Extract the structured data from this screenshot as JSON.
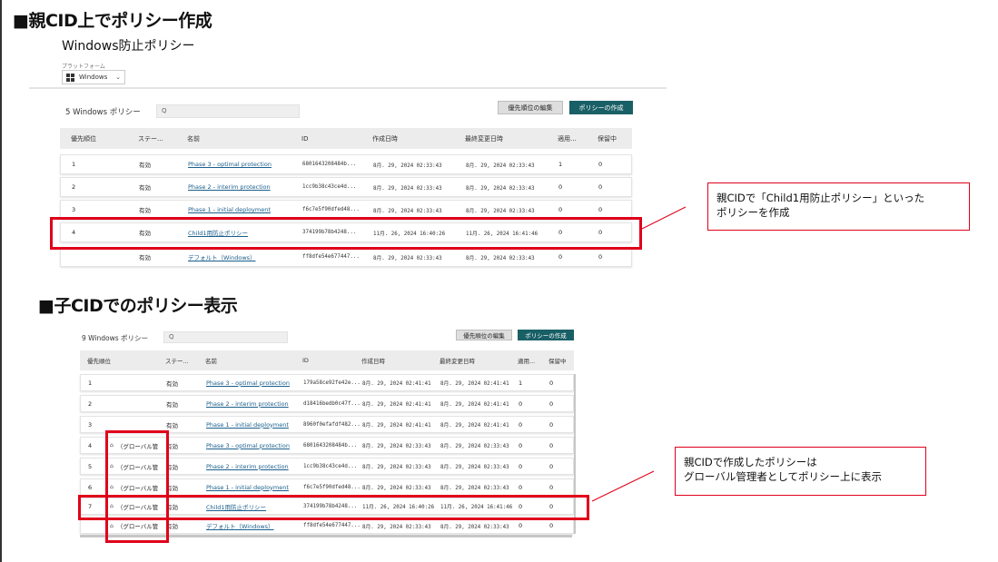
{
  "heading1": "■親CID上でポリシー作成",
  "heading2": "■子CIDでのポリシー表示",
  "parent": {
    "title": "Windows防止ポリシー",
    "platform_label": "プラットフォーム",
    "platform_value": "Windows",
    "count_label": "5 Windows ポリシー",
    "search_placeholder": "Q",
    "edit_priority_label": "優先順位の編集",
    "create_policy_label": "ポリシーの作成",
    "columns": [
      "優先順位",
      "ステー...",
      "名前",
      "ID",
      "作成日時",
      "最終変更日時",
      "適用...",
      "保留中"
    ],
    "rows": [
      {
        "priority": "1",
        "status": "有効",
        "name": "Phase 3 - optimal protection",
        "id": "6801643208484b...",
        "created": "8月. 29, 2024 02:33:43",
        "modified": "8月. 29, 2024 02:33:43",
        "applied": "1",
        "pending": "0"
      },
      {
        "priority": "2",
        "status": "有効",
        "name": "Phase 2 - interim protection",
        "id": "1cc9b38c43ce4d...",
        "created": "8月. 29, 2024 02:33:43",
        "modified": "8月. 29, 2024 02:33:43",
        "applied": "0",
        "pending": "0"
      },
      {
        "priority": "3",
        "status": "有効",
        "name": "Phase 1 - initial deployment",
        "id": "f6c7e5f90dfed48...",
        "created": "8月. 29, 2024 02:33:43",
        "modified": "8月. 29, 2024 02:33:43",
        "applied": "0",
        "pending": "0"
      },
      {
        "priority": "4",
        "status": "有効",
        "name": "Child1用防止ポリシー",
        "id": "374199b78b4248...",
        "created": "11月. 26, 2024 16:40:26",
        "modified": "11月. 26, 2024 16:41:46",
        "applied": "0",
        "pending": "0"
      },
      {
        "priority": "",
        "status": "有効",
        "name": "デフォルト（Windows）",
        "id": "ff8dfe54e677447...",
        "created": "8月. 29, 2024 02:33:43",
        "modified": "8月. 29, 2024 02:33:43",
        "applied": "0",
        "pending": "0"
      }
    ]
  },
  "child": {
    "count_label": "9 Windows ポリシー",
    "search_placeholder": "Q",
    "edit_priority_label": "優先順位の編集",
    "create_policy_label": "ポリシーの作成",
    "columns": [
      "優先順位",
      "ステー...",
      "名前",
      "ID",
      "作成日時",
      "最終変更日時",
      "適用...",
      "保留中"
    ],
    "rows": [
      {
        "priority": "1",
        "global": "",
        "status": "有効",
        "name": "Phase 3 - optimal protection",
        "id": "179a58ce92fe42e...",
        "created": "8月. 29, 2024 02:41:41",
        "modified": "8月. 29, 2024 02:41:41",
        "applied": "1",
        "pending": "0"
      },
      {
        "priority": "2",
        "global": "",
        "status": "有効",
        "name": "Phase 2 - interim protection",
        "id": "d18416bedb0c47f...",
        "created": "8月. 29, 2024 02:41:41",
        "modified": "8月. 29, 2024 02:41:41",
        "applied": "0",
        "pending": "0"
      },
      {
        "priority": "3",
        "global": "",
        "status": "有効",
        "name": "Phase 1 - initial deployment",
        "id": "8960f0efafdf482...",
        "created": "8月. 29, 2024 02:41:41",
        "modified": "8月. 29, 2024 02:41:41",
        "applied": "0",
        "pending": "0"
      },
      {
        "priority": "4",
        "global": "（グローバル管",
        "status": "有効",
        "name": "Phase 3 - optimal protection",
        "id": "6801643208484b...",
        "created": "8月. 29, 2024 02:33:43",
        "modified": "8月. 29, 2024 02:33:43",
        "applied": "0",
        "pending": "0"
      },
      {
        "priority": "5",
        "global": "（グローバル管",
        "status": "有効",
        "name": "Phase 2 - interim protection",
        "id": "1cc9b38c43ce4d...",
        "created": "8月. 29, 2024 02:33:43",
        "modified": "8月. 29, 2024 02:33:43",
        "applied": "0",
        "pending": "0"
      },
      {
        "priority": "6",
        "global": "（グローバル管",
        "status": "有効",
        "name": "Phase 1 - initial deployment",
        "id": "f6c7e5f90dfed48...",
        "created": "8月. 29, 2024 02:33:43",
        "modified": "8月. 29, 2024 02:33:43",
        "applied": "0",
        "pending": "0"
      },
      {
        "priority": "7",
        "global": "（グローバル管",
        "status": "有効",
        "name": "Child1用防止ポリシー",
        "id": "374199b78b4248...",
        "created": "11月. 26, 2024 16:40:26",
        "modified": "11月. 26, 2024 16:41:46",
        "applied": "0",
        "pending": "0"
      },
      {
        "priority": "",
        "global": "（グローバル管",
        "status": "有効",
        "name": "デフォルト（Windows）",
        "id": "ff8dfe54e677447...",
        "created": "8月. 29, 2024 02:33:43",
        "modified": "8月. 29, 2024 02:33:43",
        "applied": "0",
        "pending": "0"
      }
    ]
  },
  "callout1": {
    "line1": "親CIDで「Child1用防止ポリシー」といった",
    "line2": "ポリシーを作成"
  },
  "callout2": {
    "line1": "親CIDで作成したポリシーは",
    "line2": "グローバル管理者としてポリシー上に表示"
  },
  "icons": {
    "platform": "windows-logo-icon",
    "dropdown": "chevron-down-icon",
    "search": "search-icon",
    "global": "globe-icon"
  },
  "colors": {
    "accent": "#195f66",
    "highlight": "#e0001b",
    "link": "#1b5f8c"
  }
}
